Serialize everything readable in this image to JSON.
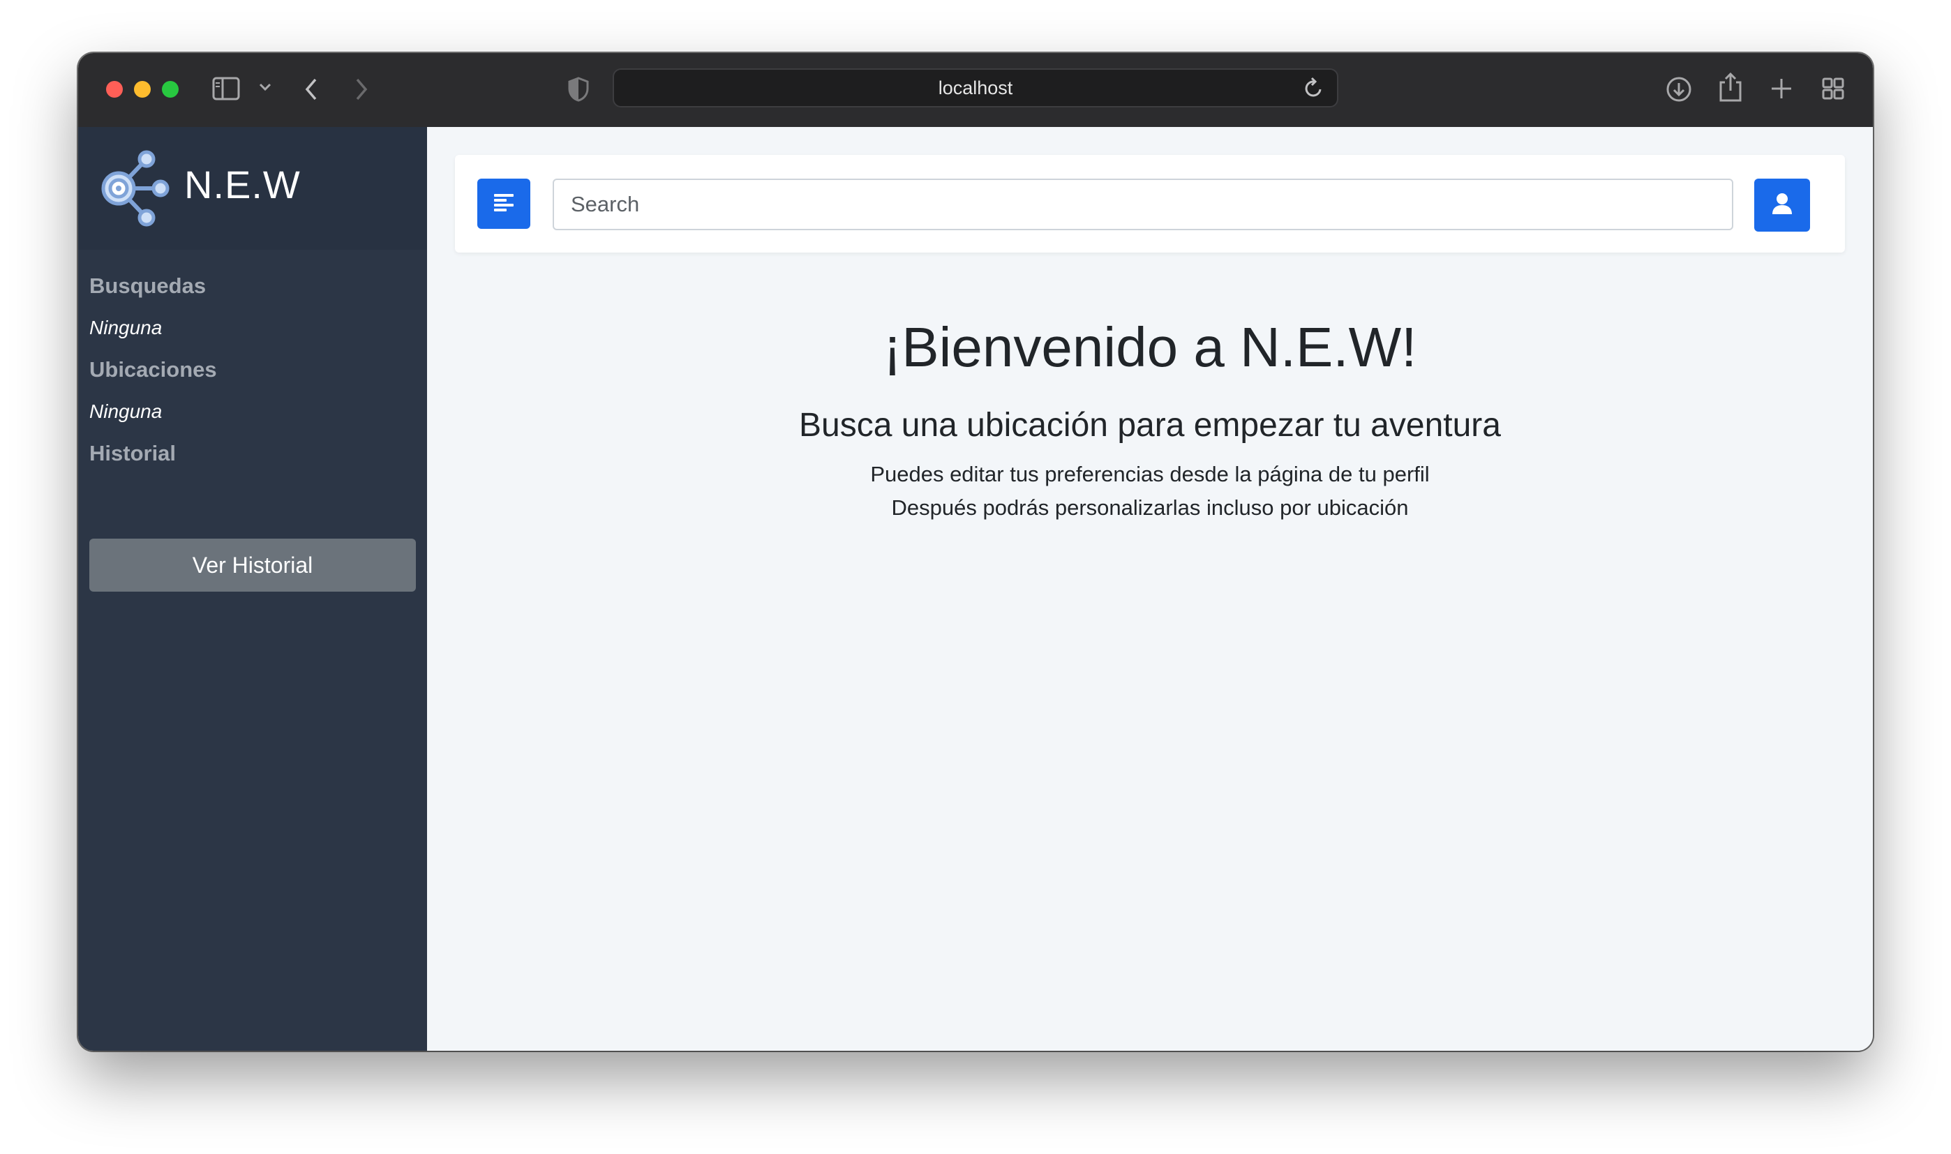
{
  "browser": {
    "address": "localhost",
    "icons": [
      "sidebar-toggle-icon",
      "chevron-down-icon",
      "back-arrow-icon",
      "forward-arrow-icon",
      "shield-icon",
      "reload-icon",
      "download-icon",
      "share-icon",
      "plus-icon",
      "tab-overview-icon"
    ]
  },
  "sidebar": {
    "brand": "N.E.W",
    "sections": {
      "searches": {
        "title": "Busquedas",
        "item": "Ninguna"
      },
      "locations": {
        "title": "Ubicaciones",
        "item": "Ninguna"
      },
      "history": {
        "title": "Historial",
        "button": "Ver Historial"
      }
    }
  },
  "topbar": {
    "search_placeholder": "Search",
    "menu_icon": "align-left-icon",
    "user_icon": "user-icon"
  },
  "welcome": {
    "title": "¡Bienvenido a N.E.W!",
    "subtitle": "Busca una ubicación para empezar tu aventura",
    "line1": "Puedes editar tus preferencias desde la página de tu perfil",
    "line2": "Después podrás personalizarlas incluso por ubicación"
  },
  "colors": {
    "sidebar_bg": "#2c3646",
    "main_bg": "#f3f6f9",
    "primary": "#1a6aea",
    "history_button": "#6b737b"
  }
}
